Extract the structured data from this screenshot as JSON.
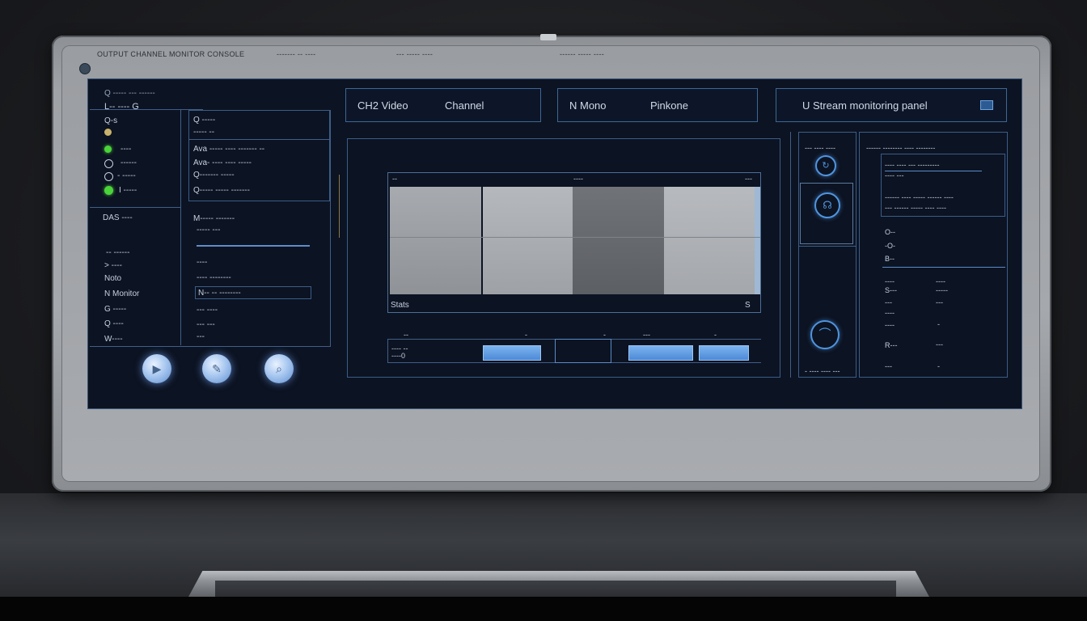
{
  "bezel": {
    "top_labels": [
      "OUTPUT CHANNEL MONITOR CONSOLE",
      "------- -- ----",
      "--- ----- ----",
      "------ ----- ----"
    ]
  },
  "left_panel": {
    "header": "Q ----- --- ------",
    "title": "L-- ---- G",
    "col_a": {
      "items": [
        {
          "label": "Q-s",
          "icon": "status-dot",
          "color": "#c9b36a"
        },
        {
          "label": "----",
          "icon": "status-dot",
          "color": "#4bd43a"
        },
        {
          "label": "------",
          "icon": "status-dot",
          "color": "#c6d1e0"
        },
        {
          "label": "- -----",
          "icon": "status-dot",
          "color": "#c6d1e0"
        },
        {
          "label": "I -----",
          "icon": "status-dot",
          "color": "#4bd43a"
        }
      ],
      "section_title": "DAS ----",
      "sub_items": [
        "-- ------",
        "> ----",
        "Noto",
        "N Monitor",
        "G -----",
        "Q ----",
        "W----"
      ]
    },
    "col_b": {
      "header": "Q -----",
      "rows": [
        "----- --",
        "Ava ----- ---- ------- --",
        "Ava- ---- ---- -----",
        "Q------- -----",
        "Q----- ----- -------"
      ],
      "section_title": "M----- -------",
      "sub_rows": [
        "----- ---",
        "----",
        "---- --------",
        "N-- -- --------",
        "--- ----",
        "--- ---",
        "---"
      ]
    },
    "buttons": [
      "play",
      "edit",
      "search"
    ]
  },
  "top_tabs": [
    {
      "left": "CH2 Video",
      "right": "Channel"
    },
    {
      "left": "N Mono",
      "right": "Pinkone"
    },
    {
      "left": "U Stream monitoring panel",
      "right": ""
    }
  ],
  "preview": {
    "header_left": "--",
    "header_mid": "----",
    "header_right": "---",
    "footer_left": "Stats",
    "footer_right": "S",
    "controls_header": [
      "--",
      "-",
      "-",
      "---",
      "-"
    ],
    "controls_label_1": "---- --",
    "controls_label_2": "----0"
  },
  "icon_column": {
    "header": "--- ---- ----",
    "footer": "- ---- ---- ---"
  },
  "right_panel": {
    "header": "------ -------- ---- --------",
    "box_lines": [
      "---- ---- --- ---------",
      "---- ---"
    ],
    "lines": [
      "------ ---- ----- ------ ----",
      "--- ------ ----- ---- ----"
    ],
    "keys": [
      "O--",
      "-O-",
      "B--",
      "----",
      "S---",
      "---",
      "----",
      "----",
      "R---",
      "---"
    ],
    "values": [
      "----",
      "-----",
      "---",
      "-",
      "---",
      "-"
    ]
  }
}
